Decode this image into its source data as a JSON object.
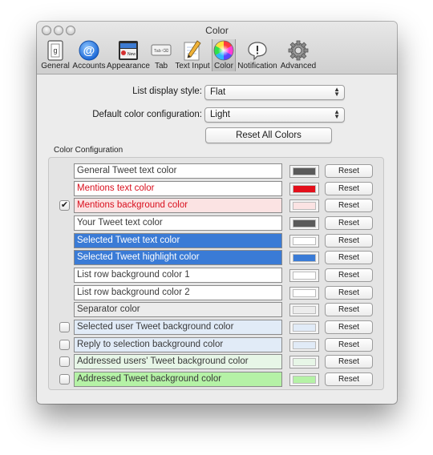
{
  "window": {
    "title": "Color"
  },
  "toolbar": {
    "items": [
      {
        "label": "General",
        "icon": "general-icon"
      },
      {
        "label": "Accounts",
        "icon": "at-sign-icon"
      },
      {
        "label": "Appearance",
        "icon": "appearance-icon"
      },
      {
        "label": "Tab",
        "icon": "tab-icon"
      },
      {
        "label": "Text Input",
        "icon": "pencil-icon"
      },
      {
        "label": "Color",
        "icon": "color-wheel-icon",
        "selected": true
      },
      {
        "label": "Notification",
        "icon": "speech-bubble-icon"
      },
      {
        "label": "Advanced",
        "icon": "gear-icon"
      }
    ],
    "tab_glyph_text": "Tab ⌫",
    "general_glyph_text": "g",
    "appearance_glyph_text": "New"
  },
  "settings": {
    "list_display_style_label": "List display style:",
    "list_display_style_value": "Flat",
    "default_color_label": "Default color configuration:",
    "default_color_value": "Light",
    "reset_all_label": "Reset All Colors"
  },
  "section": {
    "label": "Color Configuration"
  },
  "colors": {
    "white": "#ffffff",
    "mentions_red": "#d90f1d",
    "selected_blue": "#3a7bd6",
    "pink_bg": "#fbe3e3",
    "blue_bg": "#e1ebf7",
    "green_bg": "#e7f6e7",
    "green_strong": "#b5f2a6",
    "gray_sep": "#ececec",
    "dark_swatch": "#5a5a5a"
  },
  "reset_label": "Reset",
  "rows": [
    {
      "label": "General Tweet text color",
      "checkbox": "none",
      "field_bg": "#ffffff",
      "field_fg": "#3a3a3a",
      "swatch": "#5a5a5a"
    },
    {
      "label": "Mentions text color",
      "checkbox": "none",
      "field_bg": "#ffffff",
      "field_fg": "#d90f1d",
      "swatch": "#e30f1b"
    },
    {
      "label": "Mentions background color",
      "checkbox": "checked",
      "field_bg": "#fbe3e3",
      "field_fg": "#d90f1d",
      "swatch": "#fbe3e3"
    },
    {
      "label": "Your Tweet text color",
      "checkbox": "none",
      "field_bg": "#ffffff",
      "field_fg": "#3a3a3a",
      "swatch": "#5a5a5a"
    },
    {
      "label": "Selected Tweet text color",
      "checkbox": "none",
      "field_bg": "#3a7bd6",
      "field_fg": "#ffffff",
      "swatch": "#ffffff"
    },
    {
      "label": "Selected Tweet highlight color",
      "checkbox": "none",
      "field_bg": "#3a7bd6",
      "field_fg": "#ffffff",
      "swatch": "#3a7bd6"
    },
    {
      "label": "List row background color 1",
      "checkbox": "none",
      "field_bg": "#ffffff",
      "field_fg": "#3a3a3a",
      "swatch": "#ffffff"
    },
    {
      "label": "List row background color 2",
      "checkbox": "none",
      "field_bg": "#ffffff",
      "field_fg": "#3a3a3a",
      "swatch": "#ffffff"
    },
    {
      "label": "Separator color",
      "checkbox": "none",
      "field_bg": "#ececec",
      "field_fg": "#3a3a3a",
      "swatch": "#ececec"
    },
    {
      "label": "Selected user Tweet background color",
      "checkbox": "unchecked",
      "field_bg": "#e1ebf7",
      "field_fg": "#3a3a3a",
      "swatch": "#e1ebf7"
    },
    {
      "label": "Reply to selection background color",
      "checkbox": "unchecked",
      "field_bg": "#e1ebf7",
      "field_fg": "#3a3a3a",
      "swatch": "#e1ebf7"
    },
    {
      "label": "Addressed users' Tweet background color",
      "checkbox": "unchecked",
      "field_bg": "#e7f6e7",
      "field_fg": "#3a3a3a",
      "swatch": "#e7f6e7"
    },
    {
      "label": "Addressed Tweet background color",
      "checkbox": "unchecked",
      "field_bg": "#b5f2a6",
      "field_fg": "#3a3a3a",
      "swatch": "#b5f2a6"
    }
  ]
}
